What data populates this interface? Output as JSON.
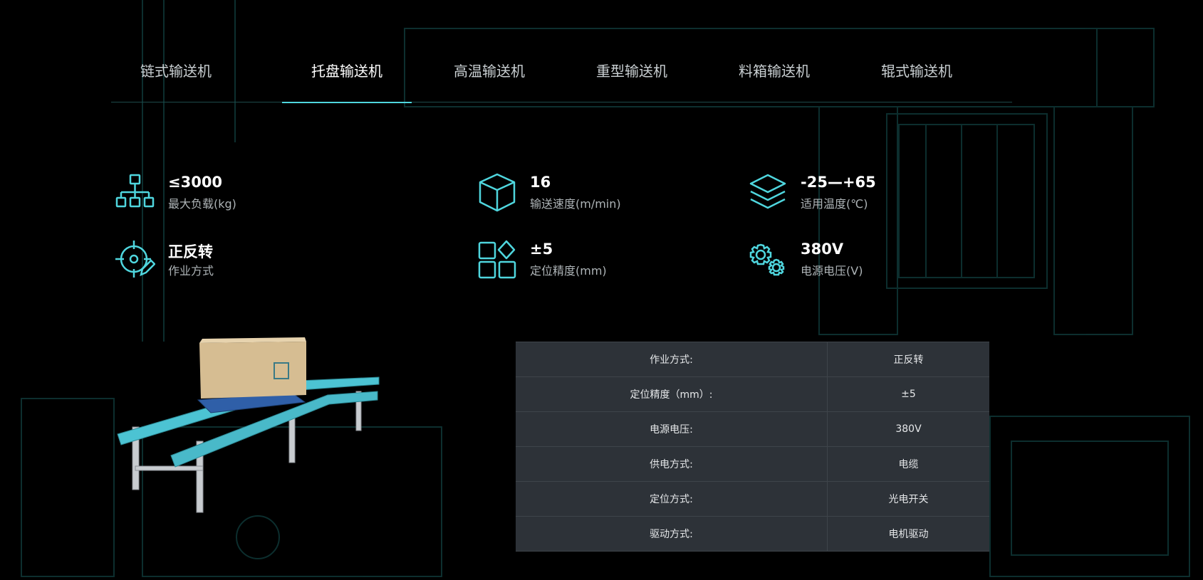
{
  "colors": {
    "accent": "#4fd6de",
    "table_bg": "#2d3238",
    "background": "#000000"
  },
  "tabs": [
    {
      "label": "链式输送机",
      "active": false
    },
    {
      "label": "托盘输送机",
      "active": true
    },
    {
      "label": "高温输送机",
      "active": false
    },
    {
      "label": "重型输送机",
      "active": false
    },
    {
      "label": "料箱输送机",
      "active": false
    },
    {
      "label": "辊式输送机",
      "active": false
    }
  ],
  "specs": [
    {
      "value": "≤3000",
      "label": "最大负载(kg)",
      "icon": "hierarchy-icon"
    },
    {
      "value": "16",
      "label": "输送速度(m/min)",
      "icon": "cube-icon"
    },
    {
      "value": "-25—+65",
      "label": "适用温度(℃)",
      "icon": "layers-icon"
    },
    {
      "value": "正反转",
      "label": "作业方式",
      "icon": "target-pencil-icon"
    },
    {
      "value": "±5",
      "label": "定位精度(mm)",
      "icon": "grid-diamond-icon"
    },
    {
      "value": "380V",
      "label": "电源电压(V)",
      "icon": "gears-icon"
    }
  ],
  "params": [
    {
      "key": "作业方式:",
      "value": "正反转"
    },
    {
      "key": "定位精度（mm）:",
      "value": "±5"
    },
    {
      "key": "电源电压:",
      "value": "380V"
    },
    {
      "key": "供电方式:",
      "value": "电缆"
    },
    {
      "key": "定位方式:",
      "value": "光电开关"
    },
    {
      "key": "驱动方式:",
      "value": "电机驱动"
    }
  ]
}
